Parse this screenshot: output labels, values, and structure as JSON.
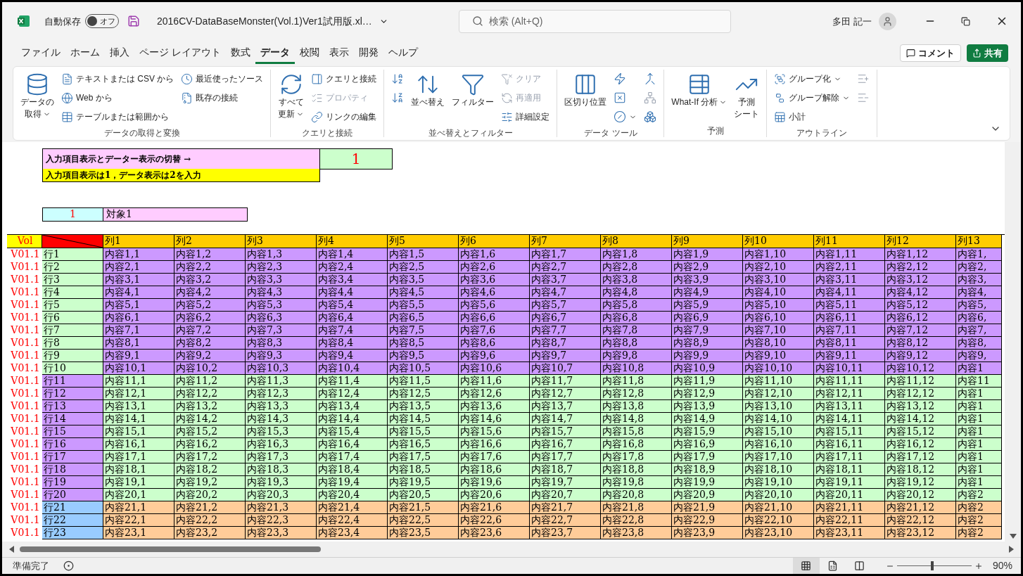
{
  "title_bar": {
    "autosave_label": "自動保存",
    "autosave_state": "オフ",
    "autosave_on": false,
    "file_name": "2016CV-DataBaseMonster(Vol.1)Ver1試用版.xl…",
    "search_placeholder": "検索 (Alt+Q)",
    "user_name": "多田 記一"
  },
  "menu_tabs": [
    {
      "label": "ファイル",
      "selected": false
    },
    {
      "label": "ホーム",
      "selected": false
    },
    {
      "label": "挿入",
      "selected": false
    },
    {
      "label": "ページ レイアウト",
      "selected": false
    },
    {
      "label": "数式",
      "selected": false
    },
    {
      "label": "データ",
      "selected": true
    },
    {
      "label": "校閲",
      "selected": false
    },
    {
      "label": "表示",
      "selected": false
    },
    {
      "label": "開発",
      "selected": false
    },
    {
      "label": "ヘルプ",
      "selected": false
    }
  ],
  "comment_button": "コメント",
  "share_button": "共有",
  "ribbon_groups": [
    {
      "title": "データの取得と変換",
      "columns": [
        [
          {
            "kind": "large",
            "lines": [
              "データの",
              "取得"
            ],
            "dropdown": true,
            "disabled": false
          }
        ],
        [
          {
            "kind": "small",
            "label": "テキストまたは CSV から",
            "dropdown": false,
            "disabled": false
          },
          {
            "kind": "small",
            "label": "Web から",
            "dropdown": false,
            "disabled": false
          },
          {
            "kind": "small",
            "label": "テーブルまたは範囲から",
            "dropdown": false,
            "disabled": false
          }
        ],
        [
          {
            "kind": "small",
            "label": "最近使ったソース",
            "dropdown": false,
            "disabled": false
          },
          {
            "kind": "small",
            "label": "既存の接続",
            "dropdown": false,
            "disabled": false
          }
        ]
      ]
    },
    {
      "title": "クエリと接続",
      "columns": [
        [
          {
            "kind": "large",
            "lines": [
              "すべて",
              "更新"
            ],
            "dropdown": true,
            "disabled": false
          }
        ],
        [
          {
            "kind": "small",
            "label": "クエリと接続",
            "dropdown": false,
            "disabled": false
          },
          {
            "kind": "small",
            "label": "プロパティ",
            "dropdown": false,
            "disabled": true
          },
          {
            "kind": "small",
            "label": "リンクの編集",
            "dropdown": false,
            "disabled": false
          }
        ]
      ]
    },
    {
      "title": "並べ替えとフィルター",
      "columns": [
        [
          {
            "kind": "icon",
            "dropdown": false,
            "disabled": false
          },
          {
            "kind": "icon",
            "dropdown": false,
            "disabled": false
          }
        ],
        [
          {
            "kind": "large",
            "lines": [
              "並べ替え"
            ],
            "dropdown": false,
            "disabled": false
          }
        ],
        [
          {
            "kind": "large",
            "lines": [
              "フィルター"
            ],
            "dropdown": false,
            "disabled": false
          }
        ],
        [
          {
            "kind": "small",
            "label": "クリア",
            "dropdown": false,
            "disabled": true
          },
          {
            "kind": "small",
            "label": "再適用",
            "dropdown": false,
            "disabled": true
          },
          {
            "kind": "small",
            "label": "詳細設定",
            "dropdown": false,
            "disabled": false
          }
        ]
      ]
    },
    {
      "title": "データ ツール",
      "columns": [
        [
          {
            "kind": "large",
            "lines": [
              "区切り位置"
            ],
            "dropdown": false,
            "disabled": false
          }
        ],
        [
          {
            "kind": "icon",
            "dropdown": false,
            "disabled": false
          },
          {
            "kind": "icon",
            "dropdown": false,
            "disabled": false
          },
          {
            "kind": "icon",
            "dropdown": true,
            "disabled": false
          }
        ],
        [
          {
            "kind": "icon",
            "dropdown": false,
            "disabled": false
          },
          {
            "kind": "icon",
            "dropdown": false,
            "disabled": true
          },
          {
            "kind": "icon",
            "dropdown": false,
            "disabled": false
          }
        ]
      ]
    },
    {
      "title": "予測",
      "columns": [
        [
          {
            "kind": "large",
            "lines": [
              "What-If 分析"
            ],
            "dropdown": true,
            "disabled": false
          }
        ],
        [
          {
            "kind": "large",
            "lines": [
              "予測",
              "シート"
            ],
            "dropdown": false,
            "disabled": false
          }
        ]
      ]
    },
    {
      "title": "アウトライン",
      "columns": [
        [
          {
            "kind": "small",
            "label": "グループ化",
            "dropdown": true,
            "disabled": false
          },
          {
            "kind": "small",
            "label": "グループ解除",
            "dropdown": true,
            "disabled": false
          },
          {
            "kind": "small",
            "label": "小計",
            "dropdown": false,
            "disabled": false
          }
        ],
        [
          {
            "kind": "icon",
            "dropdown": false,
            "disabled": true
          },
          {
            "kind": "icon",
            "dropdown": false,
            "disabled": true
          }
        ]
      ]
    }
  ],
  "switch_panel": {
    "prompt": "入力項目表示とデーター表示の切替 →",
    "hint": "入力項目表示は1，データ表示は2を入力",
    "value": "1"
  },
  "target": {
    "number": "1",
    "name": "対象1"
  },
  "grid": {
    "vol_header": "Vol",
    "columns": [
      "列1",
      "列2",
      "列3",
      "列4",
      "列5",
      "列6",
      "列7",
      "列8",
      "列9",
      "列10",
      "列11",
      "列12",
      "列13"
    ],
    "rows": [
      {
        "vol": "V01.1",
        "label": {
          "text": "行1",
          "color": "#ccffcc"
        },
        "color": "#cc99ff",
        "cells": [
          "内容1,1",
          "内容1,2",
          "内容1,3",
          "内容1,4",
          "内容1,5",
          "内容1,6",
          "内容1,7",
          "内容1,8",
          "内容1,9",
          "内容1,10",
          "内容1,11",
          "内容1,12",
          "内容1,"
        ]
      },
      {
        "vol": "V01.1",
        "label": {
          "text": "行2",
          "color": "#ccffcc"
        },
        "color": "#cc99ff",
        "cells": [
          "内容2,1",
          "内容2,2",
          "内容2,3",
          "内容2,4",
          "内容2,5",
          "内容2,6",
          "内容2,7",
          "内容2,8",
          "内容2,9",
          "内容2,10",
          "内容2,11",
          "内容2,12",
          "内容2,"
        ]
      },
      {
        "vol": "V01.1",
        "label": {
          "text": "行3",
          "color": "#ccffcc"
        },
        "color": "#cc99ff",
        "cells": [
          "内容3,1",
          "内容3,2",
          "内容3,3",
          "内容3,4",
          "内容3,5",
          "内容3,6",
          "内容3,7",
          "内容3,8",
          "内容3,9",
          "内容3,10",
          "内容3,11",
          "内容3,12",
          "内容3,"
        ]
      },
      {
        "vol": "V01.1",
        "label": {
          "text": "行4",
          "color": "#ccffcc"
        },
        "color": "#cc99ff",
        "cells": [
          "内容4,1",
          "内容4,2",
          "内容4,3",
          "内容4,4",
          "内容4,5",
          "内容4,6",
          "内容4,7",
          "内容4,8",
          "内容4,9",
          "内容4,10",
          "内容4,11",
          "内容4,12",
          "内容4,"
        ]
      },
      {
        "vol": "V01.1",
        "label": {
          "text": "行5",
          "color": "#ccffcc"
        },
        "color": "#cc99ff",
        "cells": [
          "内容5,1",
          "内容5,2",
          "内容5,3",
          "内容5,4",
          "内容5,5",
          "内容5,6",
          "内容5,7",
          "内容5,8",
          "内容5,9",
          "内容5,10",
          "内容5,11",
          "内容5,12",
          "内容5,"
        ]
      },
      {
        "vol": "V01.1",
        "label": {
          "text": "行6",
          "color": "#ccffcc"
        },
        "color": "#cc99ff",
        "cells": [
          "内容6,1",
          "内容6,2",
          "内容6,3",
          "内容6,4",
          "内容6,5",
          "内容6,6",
          "内容6,7",
          "内容6,8",
          "内容6,9",
          "内容6,10",
          "内容6,11",
          "内容6,12",
          "内容6,"
        ]
      },
      {
        "vol": "V01.1",
        "label": {
          "text": "行7",
          "color": "#ccffcc"
        },
        "color": "#cc99ff",
        "cells": [
          "内容7,1",
          "内容7,2",
          "内容7,3",
          "内容7,4",
          "内容7,5",
          "内容7,6",
          "内容7,7",
          "内容7,8",
          "内容7,9",
          "内容7,10",
          "内容7,11",
          "内容7,12",
          "内容7,"
        ]
      },
      {
        "vol": "V01.1",
        "label": {
          "text": "行8",
          "color": "#ccffcc"
        },
        "color": "#cc99ff",
        "cells": [
          "内容8,1",
          "内容8,2",
          "内容8,3",
          "内容8,4",
          "内容8,5",
          "内容8,6",
          "内容8,7",
          "内容8,8",
          "内容8,9",
          "内容8,10",
          "内容8,11",
          "内容8,12",
          "内容8,"
        ]
      },
      {
        "vol": "V01.1",
        "label": {
          "text": "行9",
          "color": "#ccffcc"
        },
        "color": "#cc99ff",
        "cells": [
          "内容9,1",
          "内容9,2",
          "内容9,3",
          "内容9,4",
          "内容9,5",
          "内容9,6",
          "内容9,7",
          "内容9,8",
          "内容9,9",
          "内容9,10",
          "内容9,11",
          "内容9,12",
          "内容9,"
        ]
      },
      {
        "vol": "V01.1",
        "label": {
          "text": "行10",
          "color": "#ccffcc"
        },
        "color": "#cc99ff",
        "cells": [
          "内容10,1",
          "内容10,2",
          "内容10,3",
          "内容10,4",
          "内容10,5",
          "内容10,6",
          "内容10,7",
          "内容10,8",
          "内容10,9",
          "内容10,10",
          "内容10,11",
          "内容10,12",
          "内容1"
        ]
      },
      {
        "vol": "V01.1",
        "label": {
          "text": "行11",
          "color": "#cc99ff"
        },
        "color": "#ccffcc",
        "cells": [
          "内容11,1",
          "内容11,2",
          "内容11,3",
          "内容11,4",
          "内容11,5",
          "内容11,6",
          "内容11,7",
          "内容11,8",
          "内容11,9",
          "内容11,10",
          "内容11,11",
          "内容11,12",
          "内容11"
        ]
      },
      {
        "vol": "V01.1",
        "label": {
          "text": "行12",
          "color": "#cc99ff"
        },
        "color": "#ccffcc",
        "cells": [
          "内容12,1",
          "内容12,2",
          "内容12,3",
          "内容12,4",
          "内容12,5",
          "内容12,6",
          "内容12,7",
          "内容12,8",
          "内容12,9",
          "内容12,10",
          "内容12,11",
          "内容12,12",
          "内容1"
        ]
      },
      {
        "vol": "V01.1",
        "label": {
          "text": "行13",
          "color": "#cc99ff"
        },
        "color": "#ccffcc",
        "cells": [
          "内容13,1",
          "内容13,2",
          "内容13,3",
          "内容13,4",
          "内容13,5",
          "内容13,6",
          "内容13,7",
          "内容13,8",
          "内容13,9",
          "内容13,10",
          "内容13,11",
          "内容13,12",
          "内容1"
        ]
      },
      {
        "vol": "V01.1",
        "label": {
          "text": "行14",
          "color": "#cc99ff"
        },
        "color": "#ccffcc",
        "cells": [
          "内容14,1",
          "内容14,2",
          "内容14,3",
          "内容14,4",
          "内容14,5",
          "内容14,6",
          "内容14,7",
          "内容14,8",
          "内容14,9",
          "内容14,10",
          "内容14,11",
          "内容14,12",
          "内容1"
        ]
      },
      {
        "vol": "V01.1",
        "label": {
          "text": "行15",
          "color": "#cc99ff"
        },
        "color": "#ccffcc",
        "cells": [
          "内容15,1",
          "内容15,2",
          "内容15,3",
          "内容15,4",
          "内容15,5",
          "内容15,6",
          "内容15,7",
          "内容15,8",
          "内容15,9",
          "内容15,10",
          "内容15,11",
          "内容15,12",
          "内容1"
        ]
      },
      {
        "vol": "V01.1",
        "label": {
          "text": "行16",
          "color": "#cc99ff"
        },
        "color": "#ccffcc",
        "cells": [
          "内容16,1",
          "内容16,2",
          "内容16,3",
          "内容16,4",
          "内容16,5",
          "内容16,6",
          "内容16,7",
          "内容16,8",
          "内容16,9",
          "内容16,10",
          "内容16,11",
          "内容16,12",
          "内容1"
        ]
      },
      {
        "vol": "V01.1",
        "label": {
          "text": "行17",
          "color": "#cc99ff"
        },
        "color": "#ccffcc",
        "cells": [
          "内容17,1",
          "内容17,2",
          "内容17,3",
          "内容17,4",
          "内容17,5",
          "内容17,6",
          "内容17,7",
          "内容17,8",
          "内容17,9",
          "内容17,10",
          "内容17,11",
          "内容17,12",
          "内容1"
        ]
      },
      {
        "vol": "V01.1",
        "label": {
          "text": "行18",
          "color": "#cc99ff"
        },
        "color": "#ccffcc",
        "cells": [
          "内容18,1",
          "内容18,2",
          "内容18,3",
          "内容18,4",
          "内容18,5",
          "内容18,6",
          "内容18,7",
          "内容18,8",
          "内容18,9",
          "内容18,10",
          "内容18,11",
          "内容18,12",
          "内容1"
        ]
      },
      {
        "vol": "V01.1",
        "label": {
          "text": "行19",
          "color": "#cc99ff"
        },
        "color": "#ccffcc",
        "cells": [
          "内容19,1",
          "内容19,2",
          "内容19,3",
          "内容19,4",
          "内容19,5",
          "内容19,6",
          "内容19,7",
          "内容19,8",
          "内容19,9",
          "内容19,10",
          "内容19,11",
          "内容19,12",
          "内容1"
        ]
      },
      {
        "vol": "V01.1",
        "label": {
          "text": "行20",
          "color": "#cc99ff"
        },
        "color": "#ccffcc",
        "cells": [
          "内容20,1",
          "内容20,2",
          "内容20,3",
          "内容20,4",
          "内容20,5",
          "内容20,6",
          "内容20,7",
          "内容20,8",
          "内容20,9",
          "内容20,10",
          "内容20,11",
          "内容20,12",
          "内容2"
        ]
      },
      {
        "vol": "V01.1",
        "label": {
          "text": "行21",
          "color": "#99ccff"
        },
        "color": "#ffcc99",
        "cells": [
          "内容21,1",
          "内容21,2",
          "内容21,3",
          "内容21,4",
          "内容21,5",
          "内容21,6",
          "内容21,7",
          "内容21,8",
          "内容21,9",
          "内容21,10",
          "内容21,11",
          "内容21,12",
          "内容2"
        ]
      },
      {
        "vol": "V01.1",
        "label": {
          "text": "行22",
          "color": "#99ccff"
        },
        "color": "#ffcc99",
        "cells": [
          "内容22,1",
          "内容22,2",
          "内容22,3",
          "内容22,4",
          "内容22,5",
          "内容22,6",
          "内容22,7",
          "内容22,8",
          "内容22,9",
          "内容22,10",
          "内容22,11",
          "内容22,12",
          "内容2"
        ]
      },
      {
        "vol": "V01.1",
        "label": {
          "text": "行23",
          "color": "#99ccff"
        },
        "color": "#ffcc99",
        "cells": [
          "内容23,1",
          "内容23,2",
          "内容23,3",
          "内容23,4",
          "内容23,5",
          "内容23,6",
          "内容23,7",
          "内容23,8",
          "内容23,9",
          "内容23,10",
          "内容23,11",
          "内容23,12",
          "内容2"
        ]
      }
    ]
  },
  "status_bar": {
    "status": "準備完了",
    "views": [
      {
        "selected": true
      },
      {
        "selected": false
      },
      {
        "selected": false
      }
    ],
    "level": 0.47,
    "zoom": "90%"
  }
}
